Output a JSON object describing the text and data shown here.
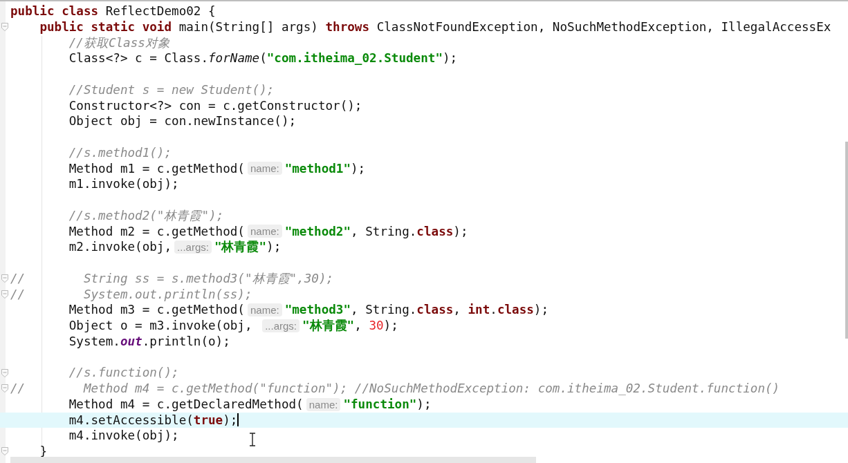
{
  "editor": {
    "lines": [
      {
        "kind": "code",
        "fold": false,
        "current": false,
        "tokens": [
          {
            "kind": "keyword",
            "text": "public class"
          },
          {
            "kind": "plain",
            "text": " ReflectDemo02 {"
          }
        ]
      },
      {
        "kind": "code",
        "fold": true,
        "current": false,
        "tokens": [
          {
            "kind": "keyword",
            "text": "    public static void"
          },
          {
            "kind": "plain",
            "text": " main(String[] args) "
          },
          {
            "kind": "keyword",
            "text": "throws"
          },
          {
            "kind": "plain",
            "text": " ClassNotFoundException, NoSuchMethodException, IllegalAccessEx"
          }
        ]
      },
      {
        "kind": "code",
        "fold": false,
        "current": false,
        "tokens": [
          {
            "kind": "comment",
            "text": "        //获取Class对象"
          }
        ]
      },
      {
        "kind": "code",
        "fold": false,
        "current": false,
        "tokens": [
          {
            "kind": "plain",
            "text": "        Class<?> c = Class."
          },
          {
            "kind": "static-method",
            "text": "forName"
          },
          {
            "kind": "plain",
            "text": "("
          },
          {
            "kind": "string",
            "text": "\"com.itheima_02.Student\""
          },
          {
            "kind": "plain",
            "text": ");"
          }
        ]
      },
      {
        "kind": "blank",
        "fold": false,
        "current": false
      },
      {
        "kind": "code",
        "fold": false,
        "current": false,
        "tokens": [
          {
            "kind": "comment",
            "text": "        //Student s = new Student();"
          }
        ]
      },
      {
        "kind": "code",
        "fold": false,
        "current": false,
        "tokens": [
          {
            "kind": "plain",
            "text": "        Constructor<?> con = c.getConstructor();"
          }
        ]
      },
      {
        "kind": "code",
        "fold": false,
        "current": false,
        "tokens": [
          {
            "kind": "plain",
            "text": "        Object obj = con.newInstance();"
          }
        ]
      },
      {
        "kind": "blank",
        "fold": false,
        "current": false
      },
      {
        "kind": "code",
        "fold": false,
        "current": false,
        "tokens": [
          {
            "kind": "comment",
            "text": "        //s.method1();"
          }
        ]
      },
      {
        "kind": "code",
        "fold": false,
        "current": false,
        "tokens": [
          {
            "kind": "plain",
            "text": "        Method m1 = c.getMethod("
          },
          {
            "kind": "hint",
            "text": "name:"
          },
          {
            "kind": "string",
            "text": "\"method1\""
          },
          {
            "kind": "plain",
            "text": ");"
          }
        ]
      },
      {
        "kind": "code",
        "fold": false,
        "current": false,
        "tokens": [
          {
            "kind": "plain",
            "text": "        m1.invoke(obj);"
          }
        ]
      },
      {
        "kind": "blank",
        "fold": false,
        "current": false
      },
      {
        "kind": "code",
        "fold": false,
        "current": false,
        "tokens": [
          {
            "kind": "comment",
            "text": "        //s.method2(\"林青霞\");"
          }
        ]
      },
      {
        "kind": "code",
        "fold": false,
        "current": false,
        "tokens": [
          {
            "kind": "plain",
            "text": "        Method m2 = c.getMethod("
          },
          {
            "kind": "hint",
            "text": "name:"
          },
          {
            "kind": "string",
            "text": "\"method2\""
          },
          {
            "kind": "plain",
            "text": ", String."
          },
          {
            "kind": "keyword",
            "text": "class"
          },
          {
            "kind": "plain",
            "text": ");"
          }
        ]
      },
      {
        "kind": "code",
        "fold": false,
        "current": false,
        "tokens": [
          {
            "kind": "plain",
            "text": "        m2.invoke(obj,"
          },
          {
            "kind": "hint",
            "text": "...args:"
          },
          {
            "kind": "string",
            "text": "\"林青霞\""
          },
          {
            "kind": "plain",
            "text": ");"
          }
        ]
      },
      {
        "kind": "blank",
        "fold": false,
        "current": false
      },
      {
        "kind": "code",
        "fold": true,
        "current": false,
        "tokens": [
          {
            "kind": "comment",
            "text": "//        String ss = s.method3(\"林青霞\",30);"
          }
        ]
      },
      {
        "kind": "code",
        "fold": true,
        "current": false,
        "tokens": [
          {
            "kind": "comment",
            "text": "//        System.out.println(ss);"
          }
        ]
      },
      {
        "kind": "code",
        "fold": false,
        "current": false,
        "tokens": [
          {
            "kind": "plain",
            "text": "        Method m3 = c.getMethod("
          },
          {
            "kind": "hint",
            "text": "name:"
          },
          {
            "kind": "string",
            "text": "\"method3\""
          },
          {
            "kind": "plain",
            "text": ", String."
          },
          {
            "kind": "keyword",
            "text": "class"
          },
          {
            "kind": "plain",
            "text": ", "
          },
          {
            "kind": "keyword",
            "text": "int"
          },
          {
            "kind": "plain",
            "text": "."
          },
          {
            "kind": "keyword",
            "text": "class"
          },
          {
            "kind": "plain",
            "text": ");"
          }
        ]
      },
      {
        "kind": "code",
        "fold": false,
        "current": false,
        "tokens": [
          {
            "kind": "plain",
            "text": "        Object o = m3.invoke(obj, "
          },
          {
            "kind": "hint",
            "text": "...args:"
          },
          {
            "kind": "string",
            "text": "\"林青霞\""
          },
          {
            "kind": "plain",
            "text": ", "
          },
          {
            "kind": "number",
            "text": "30"
          },
          {
            "kind": "plain",
            "text": ");"
          }
        ]
      },
      {
        "kind": "code",
        "fold": false,
        "current": false,
        "tokens": [
          {
            "kind": "plain",
            "text": "        System."
          },
          {
            "kind": "field",
            "text": "out"
          },
          {
            "kind": "plain",
            "text": ".println(o);"
          }
        ]
      },
      {
        "kind": "blank",
        "fold": false,
        "current": false
      },
      {
        "kind": "code",
        "fold": true,
        "current": false,
        "tokens": [
          {
            "kind": "comment",
            "text": "        //s.function();"
          }
        ]
      },
      {
        "kind": "code",
        "fold": true,
        "current": false,
        "tokens": [
          {
            "kind": "comment",
            "text": "//        Method m4 = c.getMethod(\"function\"); //NoSuchMethodException: com.itheima_02.Student.function()"
          }
        ]
      },
      {
        "kind": "code",
        "fold": false,
        "current": false,
        "tokens": [
          {
            "kind": "plain",
            "text": "        Method m4 = c.getDeclaredMethod("
          },
          {
            "kind": "hint",
            "text": "name:"
          },
          {
            "kind": "string",
            "text": "\"function\""
          },
          {
            "kind": "plain",
            "text": ");"
          }
        ]
      },
      {
        "kind": "code",
        "fold": false,
        "current": true,
        "tokens": [
          {
            "kind": "plain",
            "text": "        m4.setAccessible("
          },
          {
            "kind": "keyword",
            "text": "true"
          },
          {
            "kind": "plain",
            "text": ");"
          }
        ]
      },
      {
        "kind": "code",
        "fold": false,
        "current": false,
        "tokens": [
          {
            "kind": "plain",
            "text": "        m4.invoke(obj);"
          }
        ]
      },
      {
        "kind": "code",
        "fold": true,
        "current": false,
        "tokens": [
          {
            "kind": "plain",
            "text": "    }"
          }
        ]
      }
    ]
  }
}
